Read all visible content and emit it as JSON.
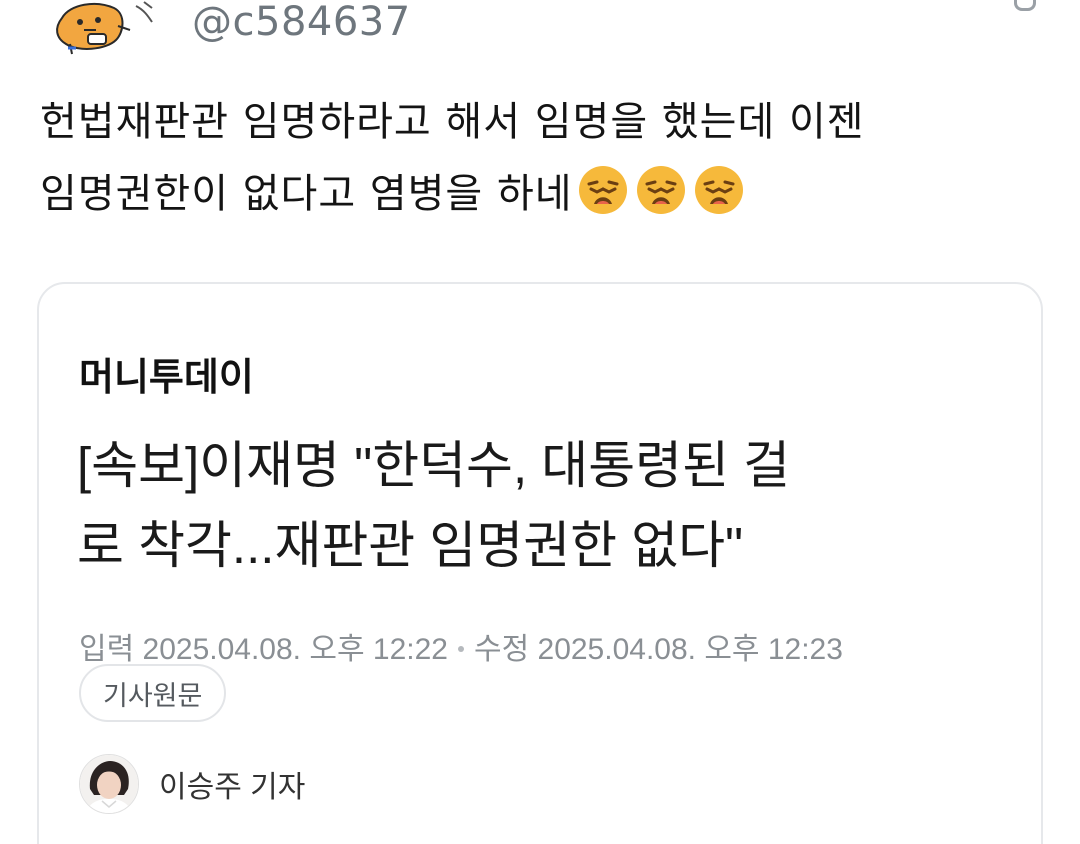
{
  "tweet": {
    "handle": "@c584637",
    "text_line1": "헌법재판관 임명하라고 해서 임명을 했는데 이젠",
    "text_line2": "임명권한이 없다고 염병을 하네",
    "emoji": [
      "weary-face-emoji",
      "weary-face-emoji",
      "weary-face-emoji"
    ]
  },
  "article": {
    "publisher": "머니투데이",
    "headline_line1": "[속보]이재명 \"한덕수, 대통령된 걸",
    "headline_line2": "로 착각...재판관 임명권한 없다\"",
    "published": "입력 2025.04.08. 오후 12:22",
    "modified": "수정 2025.04.08. 오후 12:23",
    "original_button": "기사원문",
    "reporter": "이승주 기자"
  },
  "colors": {
    "handle": "#6e767d",
    "meta": "#8a8f94",
    "card_border": "#e6e8eb",
    "emoji_face": "#f6b93b"
  }
}
